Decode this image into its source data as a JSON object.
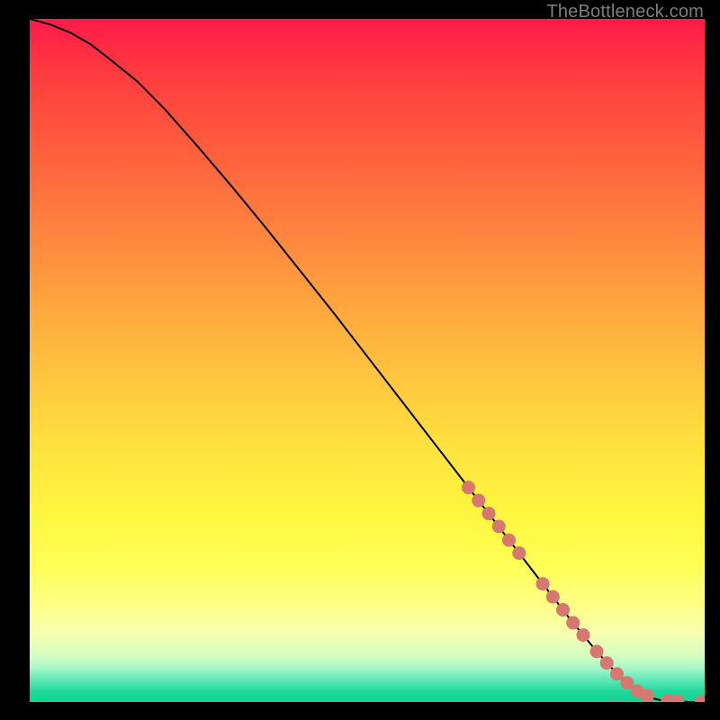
{
  "watermark": "TheBottleneck.com",
  "colors": {
    "curve_stroke": "#000000",
    "marker_fill": "#d67770",
    "background_black": "#000000"
  },
  "chart_data": {
    "type": "line",
    "title": "",
    "xlabel": "",
    "ylabel": "",
    "xlim": [
      0,
      100
    ],
    "ylim": [
      0,
      100
    ],
    "grid": false,
    "series": [
      {
        "name": "curve",
        "x": [
          0,
          3,
          6,
          9,
          12,
          16,
          20,
          25,
          30,
          35,
          40,
          45,
          50,
          55,
          60,
          65,
          70,
          75,
          80,
          82,
          84,
          86,
          88,
          90,
          92,
          94,
          96,
          98,
          100
        ],
        "y": [
          100,
          99.2,
          98.0,
          96.3,
          94.0,
          90.8,
          86.8,
          81.2,
          75.4,
          69.4,
          63.2,
          57.0,
          50.6,
          44.2,
          37.8,
          31.4,
          25.0,
          18.6,
          12.2,
          9.8,
          7.4,
          5.2,
          3.2,
          1.6,
          0.6,
          0.15,
          0.05,
          0.0,
          0.0
        ]
      }
    ],
    "markers": {
      "name": "highlighted-points",
      "points": [
        {
          "x": 65.0,
          "y": 31.4
        },
        {
          "x": 66.5,
          "y": 29.5
        },
        {
          "x": 68.0,
          "y": 27.6
        },
        {
          "x": 69.5,
          "y": 25.7
        },
        {
          "x": 71.0,
          "y": 23.7
        },
        {
          "x": 72.5,
          "y": 21.8
        },
        {
          "x": 76.0,
          "y": 17.3
        },
        {
          "x": 77.5,
          "y": 15.4
        },
        {
          "x": 79.0,
          "y": 13.5
        },
        {
          "x": 80.5,
          "y": 11.6
        },
        {
          "x": 82.0,
          "y": 9.8
        },
        {
          "x": 84.0,
          "y": 7.4
        },
        {
          "x": 85.5,
          "y": 5.7
        },
        {
          "x": 87.0,
          "y": 4.1
        },
        {
          "x": 88.5,
          "y": 2.8
        },
        {
          "x": 90.0,
          "y": 1.6
        },
        {
          "x": 91.5,
          "y": 0.9
        },
        {
          "x": 94.5,
          "y": 0.2
        },
        {
          "x": 96.0,
          "y": 0.1
        },
        {
          "x": 99.5,
          "y": 0.0
        }
      ]
    }
  }
}
